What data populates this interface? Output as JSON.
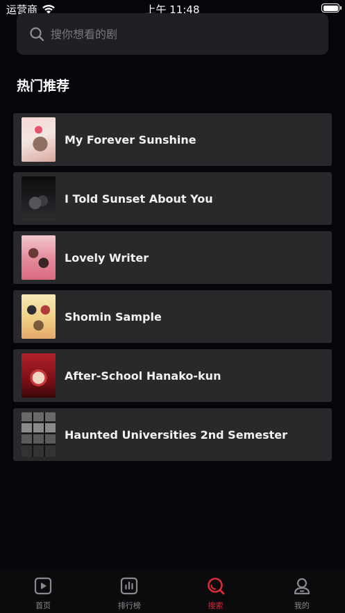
{
  "status_bar": {
    "carrier": "运营商",
    "time": "上午 11:48"
  },
  "search": {
    "placeholder": "搜你想看的剧"
  },
  "section_title": "热门推荐",
  "items": [
    {
      "title": "My Forever Sunshine"
    },
    {
      "title": "I Told Sunset About You"
    },
    {
      "title": "Lovely Writer"
    },
    {
      "title": "Shomin Sample"
    },
    {
      "title": "After-School Hanako-kun"
    },
    {
      "title": "Haunted Universities 2nd Semester"
    }
  ],
  "tabs": [
    {
      "label": "首页",
      "icon": "play-icon",
      "active": false
    },
    {
      "label": "排行榜",
      "icon": "chart-icon",
      "active": false
    },
    {
      "label": "搜索",
      "icon": "search-icon",
      "active": true
    },
    {
      "label": "我的",
      "icon": "user-icon",
      "active": false
    }
  ],
  "colors": {
    "background": "#05060b",
    "card": "#29292b",
    "accent": "#d92b3a"
  }
}
